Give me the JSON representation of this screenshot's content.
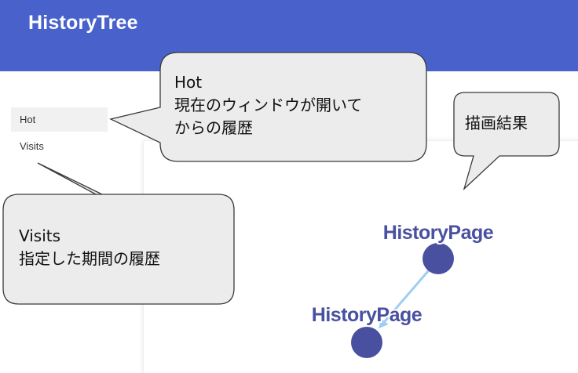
{
  "header": {
    "title": "HistoryTree",
    "color": "#4962cb"
  },
  "sidebar": {
    "items": [
      {
        "label": "Hot",
        "selected": true
      },
      {
        "label": "Visits",
        "selected": false
      }
    ]
  },
  "graph": {
    "nodes": [
      {
        "label": "HistoryPage",
        "color": "#48509f"
      },
      {
        "label": "HistoryPage",
        "color": "#48509f"
      }
    ],
    "edge_color": "#9fcdf3"
  },
  "callouts": {
    "hot": {
      "line1": "Hot",
      "line2": "現在のウィンドウが開いて",
      "line3": "からの履歴"
    },
    "visits": {
      "line1": "Visits",
      "line2": "指定した期間の履歴"
    },
    "result": {
      "line1": "描画結果"
    }
  }
}
